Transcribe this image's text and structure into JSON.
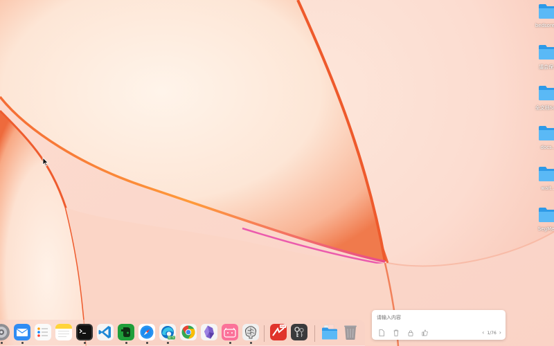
{
  "desktop": {
    "folders": [
      {
        "label": "bedsore_..."
      },
      {
        "label": "議会保..."
      },
      {
        "label": "全文档Sol..."
      },
      {
        "label": "docs..."
      },
      {
        "label": "wait..."
      },
      {
        "label": "SegMe..."
      }
    ]
  },
  "notes_widget": {
    "placeholder": "请输入内容",
    "page_indicator": "1/76",
    "tools": [
      "document-icon",
      "trash-icon",
      "lock-icon",
      "like-icon"
    ],
    "prev_icon": "chevron-left-icon",
    "next_icon": "chevron-right-icon"
  },
  "dock": {
    "apps": [
      {
        "name": "system-preferences"
      },
      {
        "name": "mail"
      },
      {
        "name": "reminders"
      },
      {
        "name": "notes"
      },
      {
        "name": "terminal"
      },
      {
        "name": "vscode"
      },
      {
        "name": "evernote"
      },
      {
        "name": "safari"
      },
      {
        "name": "edge-beta",
        "badge": "BETA"
      },
      {
        "name": "chrome"
      },
      {
        "name": "obsidian"
      },
      {
        "name": "bilibili"
      },
      {
        "name": "neural-app"
      },
      {
        "name": "pdf-expert",
        "badge": "PDF"
      },
      {
        "name": "keychain"
      },
      {
        "name": "downloads-folder"
      },
      {
        "name": "trash"
      }
    ]
  },
  "colors": {
    "folder": "#36a7f0",
    "wallpaper_base": "#fbd9cd",
    "wallpaper_accent": "#f06a3e"
  }
}
